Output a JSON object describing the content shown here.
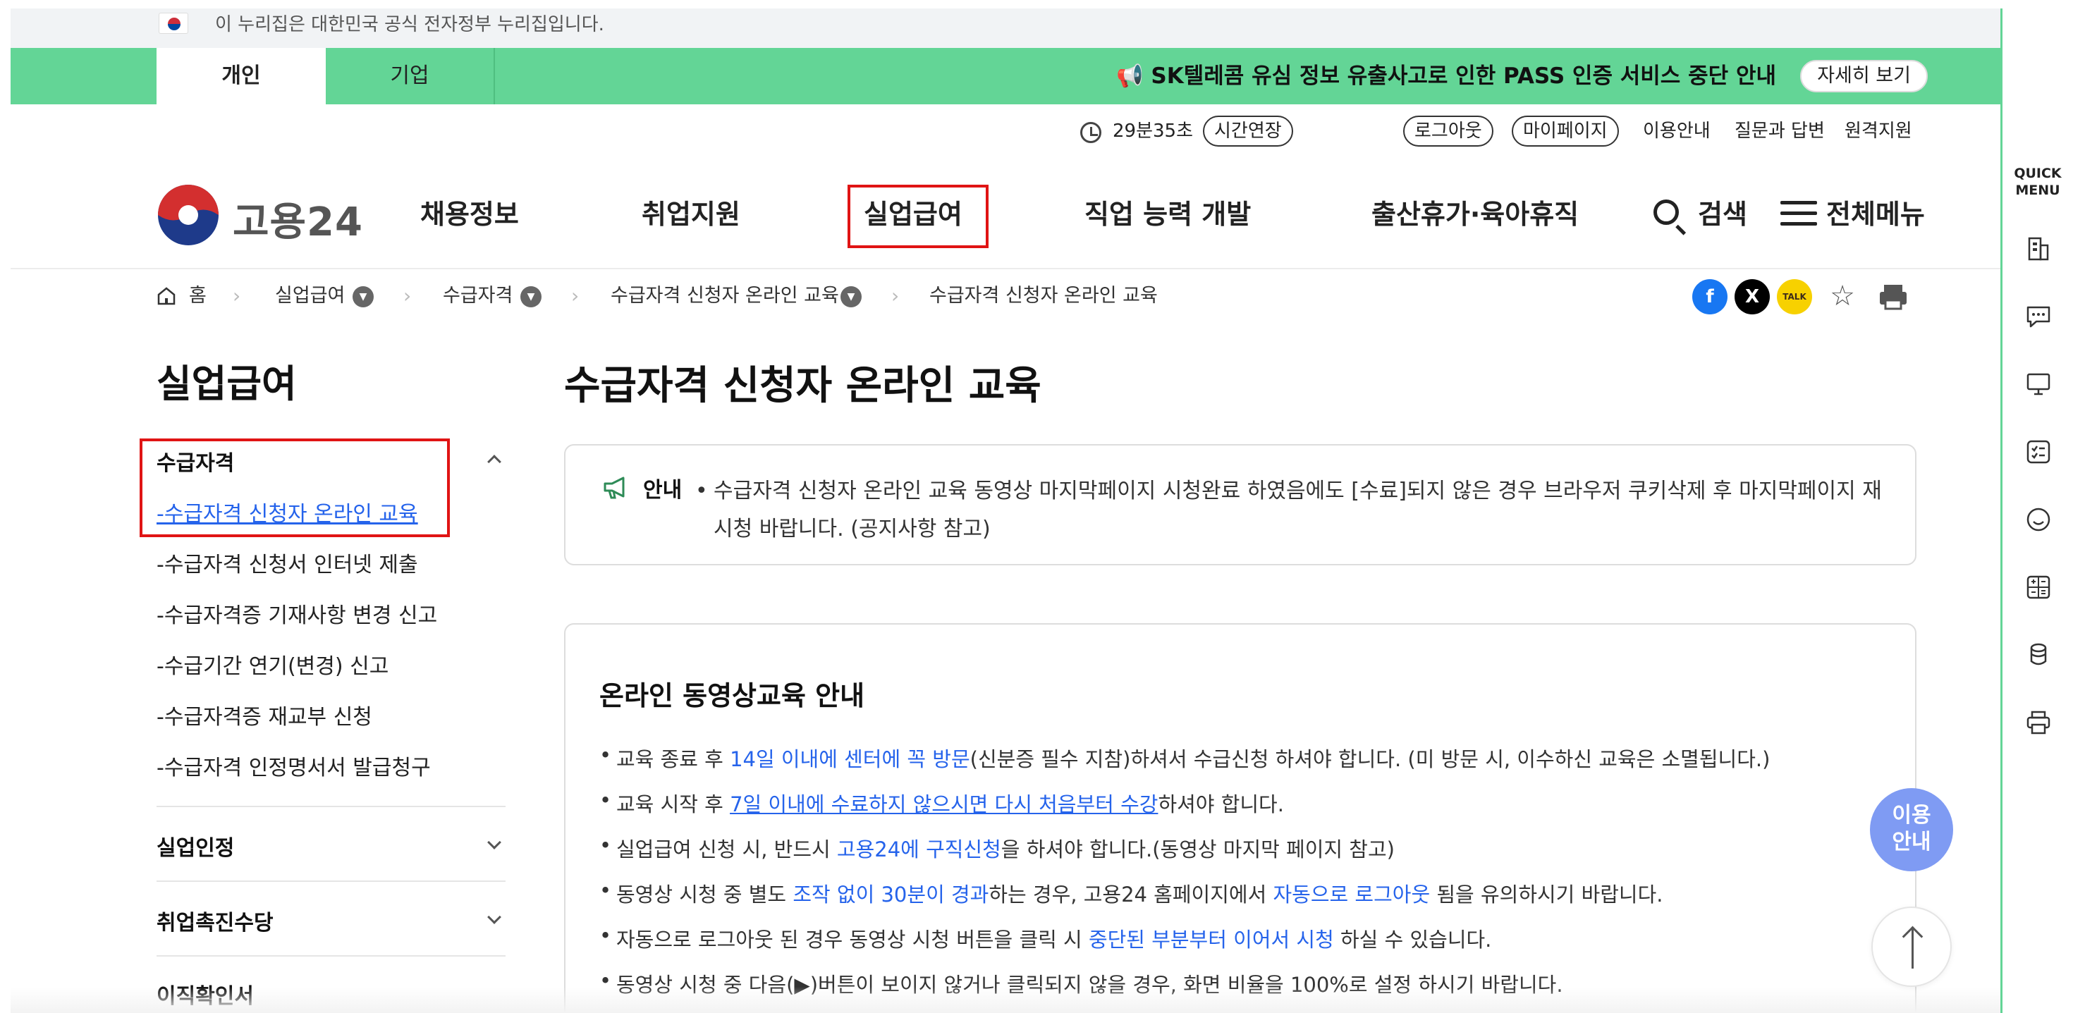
{
  "gov_banner": {
    "text": "이 누리집은 대한민국 공식 전자정부 누리집입니다."
  },
  "top_bar": {
    "tabs": [
      {
        "label": "개인"
      },
      {
        "label": "기업"
      }
    ],
    "notice": "📢 SK텔레콤 유심 정보 유출사고로 인한 PASS 인증 서비스 중단 안내",
    "notice_button": "자세히 보기"
  },
  "utility": {
    "timer": "29분35초",
    "extend": "시간연장",
    "logout": "로그아웃",
    "mypage": "마이페이지",
    "guide": "이용안내",
    "qna": "질문과 답변",
    "remote": "원격지원"
  },
  "header": {
    "logo_text": "고용24",
    "gnb": [
      {
        "label": "채용정보"
      },
      {
        "label": "취업지원"
      },
      {
        "label": "실업급여"
      },
      {
        "label": "직업 능력 개발"
      },
      {
        "label": "출산휴가·육아휴직"
      }
    ],
    "search": "검색",
    "all_menu": "전체메뉴"
  },
  "breadcrumb": {
    "home": "홈",
    "items": [
      "실업급여",
      "수급자격",
      "수급자격 신청자 온라인 교육",
      "수급자격 신청자 온라인 교육"
    ]
  },
  "share": {
    "facebook": "f",
    "x": "X",
    "kakao": "TALK"
  },
  "sidebar": {
    "title": "실업급여",
    "section1": "수급자격",
    "items": [
      "-수급자격 신청자 온라인 교육",
      "-수급자격 신청서 인터넷 제출",
      "-수급자격증 기재사항 변경 신고",
      "-수급기간 연기(변경) 신고",
      "-수급자격증 재교부 신청",
      "-수급자격 인정명서서 발급청구"
    ],
    "section2": "실업인정",
    "section3": "취업촉진수당",
    "section4": "이직확인서"
  },
  "content": {
    "title": "수급자격 신청자 온라인 교육",
    "notice_label": "안내",
    "notice_body": "수급자격 신청자 온라인 교육 동영상 마지막페이지 시청완료 하였음에도 [수료]되지 않은 경우 브라우저 쿠키삭제 후 마지막페이지 재시청 바랍니다. (공지사항 참고)",
    "edu_title": "온라인 동영상교육 안내",
    "edu": {
      "l1a": "교육 종료 후 ",
      "l1b": "14일 이내에 센터에 꼭 방문",
      "l1c": "(신분증 필수 지참)하셔서 수급신청 하셔야 합니다. (미 방문 시, 이수하신 교육은 소멸됩니다.)",
      "l2a": "교육 시작 후 ",
      "l2b": "7일 이내에 수료하지 않으시면 다시 처음부터 수강",
      "l2c": "하셔야 합니다.",
      "l3a": "실업급여 신청 시, 반드시 ",
      "l3b": "고용24에 구직신청",
      "l3c": "을 하셔야 합니다.(동영상 마지막 페이지 참고)",
      "l4a": "동영상 시청 중 별도 ",
      "l4b": "조작 없이 30분이 경과",
      "l4c": "하는 경우, 고용24 홈페이지에서 ",
      "l4d": "자동으로 로그아웃",
      "l4e": " 됨을 유의하시기 바랍니다.",
      "l5a": "자동으로 로그아웃 된 경우 동영상 시청 버튼을 클릭 시 ",
      "l5b": "중단된 부분부터 이어서 시청",
      "l5c": " 하실 수 있습니다.",
      "l6": "동영상 시청 중 다음(▶)버튼이 보이지 않거나 클릭되지 않을 경우, 화면 비율을 100%로 설정 하시기 바랍니다."
    }
  },
  "floating": {
    "help_line1": "이용",
    "help_line2": "안내"
  },
  "quick": {
    "title_line1": "QUICK",
    "title_line2": "MENU"
  },
  "colors": {
    "brand_green": "#63d596",
    "link_blue": "#2563eb",
    "highlight_red": "#e01414",
    "help_blue": "#7f9bf3"
  }
}
